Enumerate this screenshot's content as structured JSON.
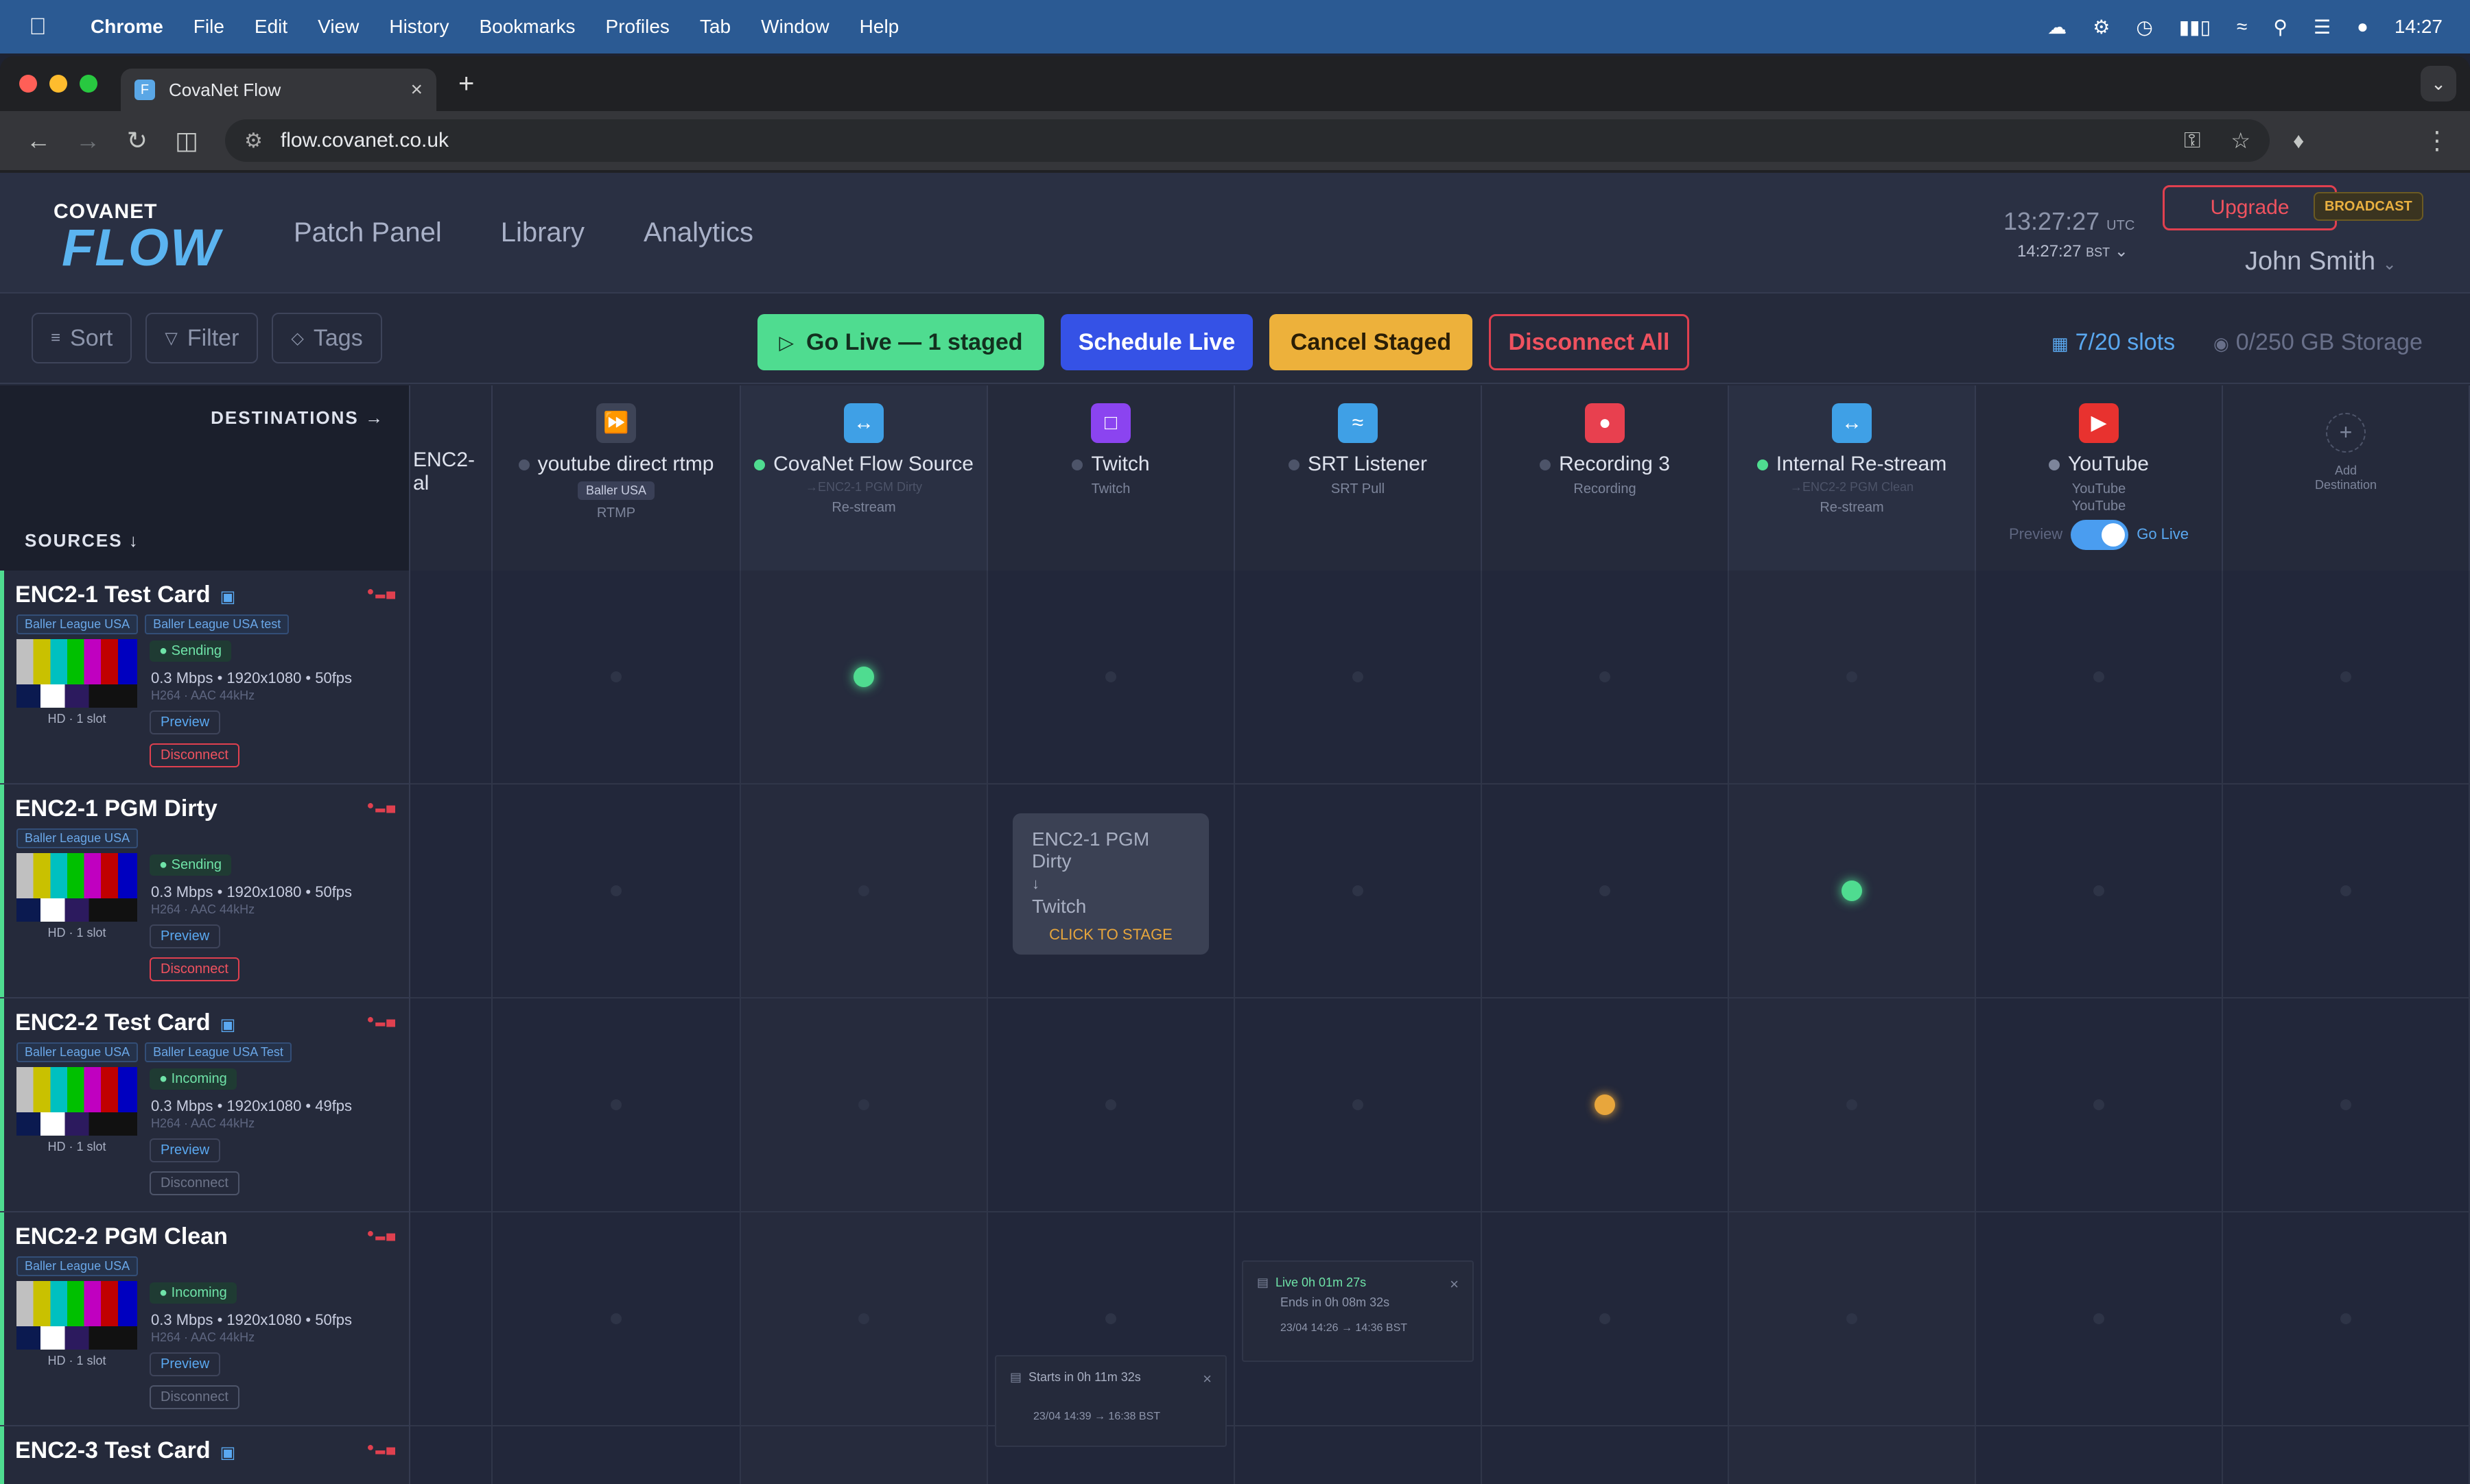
{
  "menubar": {
    "app": "Chrome",
    "items": [
      "File",
      "Edit",
      "View",
      "History",
      "Bookmarks",
      "Profiles",
      "Tab",
      "Window",
      "Help"
    ],
    "time": "14:27"
  },
  "browser": {
    "tab_title": "CovaNet Flow",
    "tab_favicon": "F",
    "url": "flow.covanet.co.uk"
  },
  "header": {
    "logo_top": "COVANET",
    "logo_bottom": "FLOW",
    "nav": [
      "Patch Panel",
      "Library",
      "Analytics"
    ],
    "utc_time": "13:27:27",
    "utc_label": "UTC",
    "bst_time": "14:27:27",
    "bst_label": "BST",
    "upgrade": "Upgrade",
    "badge": "BROADCAST",
    "user": "John Smith"
  },
  "actions": {
    "sort": "Sort",
    "filter": "Filter",
    "tags": "Tags",
    "go_live": "Go Live — 1 staged",
    "schedule": "Schedule Live",
    "cancel_staged": "Cancel Staged",
    "disconnect_all": "Disconnect All",
    "slots": "7/20 slots",
    "storage": "0/250 GB Storage"
  },
  "grid": {
    "destinations_label": "DESTINATIONS →",
    "sources_label": "SOURCES ↓",
    "columns": [
      {
        "name": "ENC2-",
        "sub": "al",
        "color": "#252a3b",
        "icon": ""
      },
      {
        "name": "youtube direct rtmp",
        "pill": "Baller USA",
        "sub": "RTMP",
        "color": "#3e4457",
        "icon": "rtmp-icon",
        "dot": "#4d5469"
      },
      {
        "name": "CovaNet Flow Source",
        "from": "→ENC2-1 PGM Dirty",
        "sub": "Re-stream",
        "color": "#3fa0e6",
        "icon": "restream-icon",
        "dot": "#4fdc90"
      },
      {
        "name": "Twitch",
        "sub": "Twitch",
        "color": "#8b44f0",
        "icon": "twitch-icon",
        "dot": "#4d5469"
      },
      {
        "name": "SRT Listener",
        "sub": "SRT Pull",
        "color": "#3fa0e6",
        "icon": "srt-icon",
        "dot": "#4d5469"
      },
      {
        "name": "Recording 3",
        "sub": "Recording",
        "color": "#e8404f",
        "icon": "record-icon",
        "dot": "#4d5469"
      },
      {
        "name": "Internal Re-stream",
        "from": "→ENC2-2 PGM Clean",
        "sub": "Re-stream",
        "color": "#3fa0e6",
        "icon": "restream-icon",
        "dot": "#4fdc90"
      },
      {
        "name": "YouTube",
        "sub": "YouTube",
        "sub2": "YouTube",
        "color": "#e8322f",
        "icon": "youtube-icon",
        "dot": "#7d859b",
        "preview_label": "Preview",
        "golive_label": "Go Live"
      }
    ],
    "add_destination": "Add Destination",
    "rows": [
      {
        "name": "ENC2-1 Test Card",
        "tags": [
          "Baller League USA",
          "Baller League USA test"
        ],
        "status": "Sending",
        "stats": "0.3 Mbps • 1920x1080 • 50fps",
        "codec": "H264 · AAC 44kHz",
        "thumb_caption": "HD · 1 slot",
        "preview": "Preview",
        "disconnect": "Disconnect",
        "monitor_icon": true
      },
      {
        "name": "ENC2-1 PGM Dirty",
        "tags": [
          "Baller League USA"
        ],
        "status": "Sending",
        "stats": "0.3 Mbps • 1920x1080 • 50fps",
        "codec": "H264 · AAC 44kHz",
        "thumb_caption": "HD · 1 slot",
        "preview": "Preview",
        "disconnect": "Disconnect"
      },
      {
        "name": "ENC2-2 Test Card",
        "tags": [
          "Baller League USA",
          "Baller League USA Test"
        ],
        "status": "Incoming",
        "stats": "0.3 Mbps • 1920x1080 • 49fps",
        "codec": "H264 · AAC 44kHz",
        "thumb_caption": "HD · 1 slot",
        "preview": "Preview",
        "disconnect": "Disconnect",
        "monitor_icon": true
      },
      {
        "name": "ENC2-2 PGM Clean",
        "tags": [
          "Baller League USA"
        ],
        "status": "Incoming",
        "stats": "0.3 Mbps • 1920x1080 • 50fps",
        "codec": "H264 · AAC 44kHz",
        "thumb_caption": "HD · 1 slot",
        "preview": "Preview",
        "disconnect": "Disconnect"
      },
      {
        "name": "ENC2-3 Test Card",
        "monitor_icon": true
      }
    ],
    "tooltip": {
      "source": "ENC2-1 PGM Dirty",
      "arrow": "↓",
      "destination": "Twitch",
      "action": "CLICK TO STAGE"
    },
    "schedule_live": {
      "line1": "Live 0h 01m 27s",
      "line2": "Ends in 0h 08m 32s",
      "line3": "23/04 14:26 → 14:36 BST"
    },
    "schedule_upcoming": {
      "line1": "Starts in 0h 11m 32s",
      "line3": "23/04 14:39 → 16:38 BST"
    }
  },
  "colors": {
    "accent_green": "#4fdc90",
    "accent_blue": "#3552e6",
    "accent_amber": "#edb13b",
    "accent_red": "#e0404f"
  }
}
